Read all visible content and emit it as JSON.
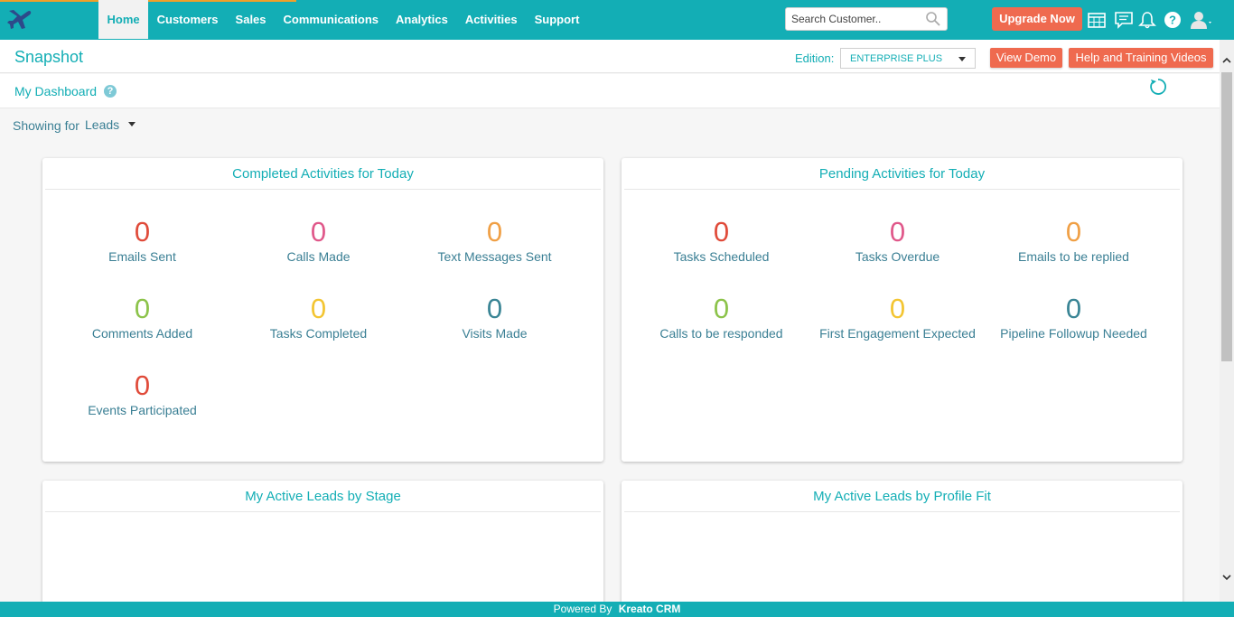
{
  "nav": {
    "items": [
      "Home",
      "Customers",
      "Sales",
      "Communications",
      "Analytics",
      "Activities",
      "Support"
    ]
  },
  "search": {
    "placeholder": "Search Customer.."
  },
  "header": {
    "upgrade_label": "Upgrade Now"
  },
  "subheader": {
    "title": "Snapshot",
    "edition_label": "Edition:",
    "edition_value": "ENTERPRISE PLUS",
    "view_demo_label": "View Demo",
    "help_videos_label": "Help and Training Videos"
  },
  "dashboard": {
    "title": "My Dashboard",
    "help_glyph": "?",
    "showing_label": "Showing for",
    "showing_value": "Leads"
  },
  "completed": {
    "title": "Completed Activities for Today",
    "metrics": [
      {
        "value": "0",
        "label": "Emails Sent",
        "color": "#e04b3a"
      },
      {
        "value": "0",
        "label": "Calls Made",
        "color": "#e0588a"
      },
      {
        "value": "0",
        "label": "Text Messages Sent",
        "color": "#f0a046"
      },
      {
        "value": "0",
        "label": "Comments Added",
        "color": "#8cc34a"
      },
      {
        "value": "0",
        "label": "Tasks Completed",
        "color": "#f3c532"
      },
      {
        "value": "0",
        "label": "Visits Made",
        "color": "#3a8595"
      },
      {
        "value": "0",
        "label": "Events Participated",
        "color": "#e04b3a"
      }
    ]
  },
  "pending": {
    "title": "Pending Activities for Today",
    "metrics": [
      {
        "value": "0",
        "label": "Tasks Scheduled",
        "color": "#e04b3a"
      },
      {
        "value": "0",
        "label": "Tasks Overdue",
        "color": "#e0588a"
      },
      {
        "value": "0",
        "label": "Emails to be replied",
        "color": "#f0a046"
      },
      {
        "value": "0",
        "label": "Calls to be responded",
        "color": "#8cc34a"
      },
      {
        "value": "0",
        "label": "First Engagement Expected",
        "color": "#f3c532"
      },
      {
        "value": "0",
        "label": "Pipeline Followup Needed",
        "color": "#3a8595"
      }
    ]
  },
  "leads_by_stage": {
    "title": "My Active Leads by Stage"
  },
  "leads_by_profile": {
    "title": "My Active Leads by Profile Fit"
  },
  "footer": {
    "prefix": "Powered By",
    "brand": "Kreato CRM"
  },
  "colors": {
    "accent": "#13aeb5",
    "orange": "#ef6a4f"
  }
}
